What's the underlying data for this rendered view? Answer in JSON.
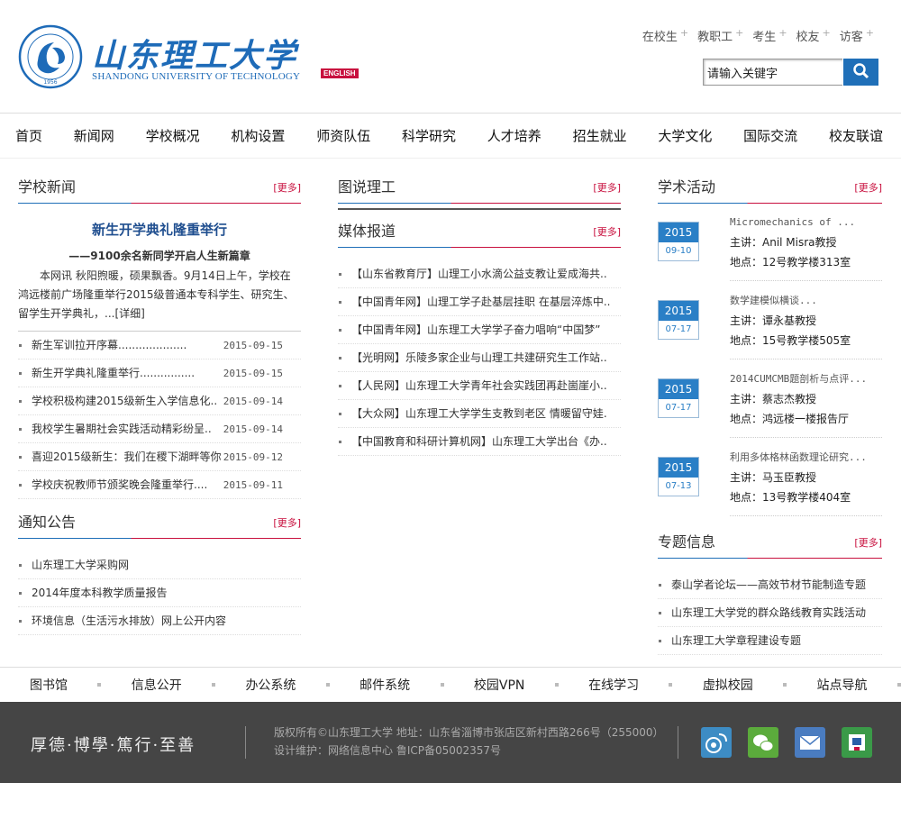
{
  "header": {
    "university_cn": "山东理工大学",
    "university_en": "SHANDONG UNIVERSITY OF TECHNOLOGY",
    "seal_year": "1956",
    "english_badge": "ENGLISH",
    "top_links": [
      "在校生",
      "教职工",
      "考生",
      "校友",
      "访客"
    ],
    "search_placeholder": "请输入关键字"
  },
  "nav": [
    "首页",
    "新闻网",
    "学校概况",
    "机构设置",
    "师资队伍",
    "科学研究",
    "人才培养",
    "招生就业",
    "大学文化",
    "国际交流",
    "校友联谊"
  ],
  "school_news": {
    "title": "学校新闻",
    "more": "[更多]",
    "headline": "新生开学典礼隆重举行",
    "subheadline": "——9100余名新同学开启人生新篇章",
    "summary": "本网讯 秋阳煦暖，硕果飘香。9月14日上午，学校在鸿远楼前广场隆重举行2015级普通本专科学生、研究生、留学生开学典礼，...[详细]",
    "items": [
      {
        "text": "新生军训拉开序幕....................",
        "date": "2015-09-15"
      },
      {
        "text": "新生开学典礼隆重举行................",
        "date": "2015-09-15"
      },
      {
        "text": "学校积极构建2015级新生入学信息化..",
        "date": "2015-09-14"
      },
      {
        "text": "我校学生暑期社会实践活动精彩纷呈..",
        "date": "2015-09-14"
      },
      {
        "text": "喜迎2015级新生：我们在稷下湖畔等你",
        "date": "2015-09-12"
      },
      {
        "text": "学校庆祝教师节颁奖晚会隆重举行....",
        "date": "2015-09-11"
      }
    ]
  },
  "notices": {
    "title": "通知公告",
    "more": "[更多]",
    "items": [
      "山东理工大学采购网",
      "2014年度本科教学质量报告",
      "环境信息（生活污水排放）网上公开内容"
    ]
  },
  "photo_news": {
    "title": "图说理工",
    "more": "[更多]"
  },
  "media": {
    "title": "媒体报道",
    "more": "[更多]",
    "items": [
      "【山东省教育厅】山理工小水滴公益支教让爱成海共..",
      "【中国青年网】山理工学子赴基层挂职 在基层淬炼中..",
      "【中国青年网】山东理工大学学子奋力唱响“中国梦”",
      "【光明网】乐陵多家企业与山理工共建研究生工作站..",
      "【人民网】山东理工大学青年社会实践团再赴崮崖小..",
      "【大众网】山东理工大学学生支教到老区 情暖留守娃.",
      "【中国教育和科研计算机网】山东理工大学出台《办.."
    ]
  },
  "academic": {
    "title": "学术活动",
    "more": "[更多]",
    "items": [
      {
        "year": "2015",
        "date": "09-10",
        "title": "Micromechanics of ...",
        "speaker": "主讲：Anil Misra教授",
        "place": "地点：12号教学楼313室"
      },
      {
        "year": "2015",
        "date": "07-17",
        "title": "数学建模似横谈...",
        "speaker": "主讲：谭永基教授",
        "place": "地点：15号教学楼505室"
      },
      {
        "year": "2015",
        "date": "07-17",
        "title": "2014CUMCMB题剖析与点评...",
        "speaker": "主讲：蔡志杰教授",
        "place": "地点：鸿远楼一楼报告厅"
      },
      {
        "year": "2015",
        "date": "07-13",
        "title": "利用多体格林函数理论研究...",
        "speaker": "主讲：马玉臣教授",
        "place": "地点：13号教学楼404室"
      }
    ]
  },
  "topics": {
    "title": "专题信息",
    "more": "[更多]",
    "items": [
      "泰山学者论坛——高效节材节能制造专题",
      "山东理工大学党的群众路线教育实践活动",
      "山东理工大学章程建设专题"
    ]
  },
  "quick_links": [
    "图书馆",
    "信息公开",
    "办公系统",
    "邮件系统",
    "校园VPN",
    "在线学习",
    "虚拟校园",
    "站点导航"
  ],
  "footer": {
    "motto": "厚德·博學·篤行·至善",
    "line1": "版权所有©山东理工大学    地址：山东省淄博市张店区新村西路266号（255000）",
    "line2": "设计维护：网络信息中心   鲁ICP备05002357号"
  }
}
